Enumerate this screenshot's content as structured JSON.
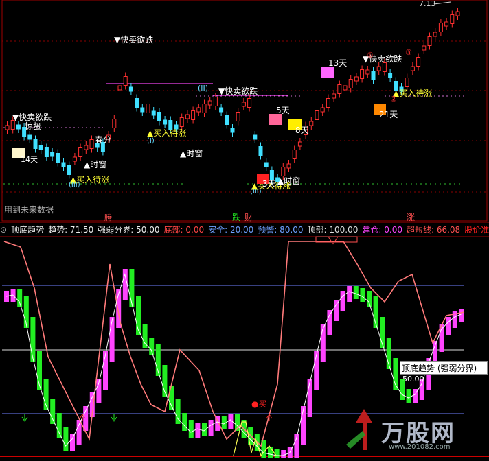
{
  "top_price": "7.13",
  "future_data_note": "用到未来数据",
  "signals": {
    "sell": "▼快卖欲跌",
    "buy": "▲买入待涨",
    "time_window": "▲时窗",
    "spring": "春分",
    "low_label": "惊蛰",
    "day13": "13天",
    "day5": "5天",
    "day8": "8天",
    "day21": "21天",
    "day3": "3天",
    "day14": "14天",
    "roman_I": "(I)",
    "roman_II": "(II)",
    "roman_III_a": "(III)",
    "roman_III_b": "(III)",
    "circle_2": "②",
    "circle_3": "③",
    "circle_1": "①"
  },
  "axis_markers": {
    "teng": "腾",
    "die": "跌",
    "cai": "财",
    "zhang": "涨"
  },
  "indicator": {
    "name": "顶底趋势",
    "trend": "趋势: 71.50",
    "strong_weak": "强弱分界: 50.00",
    "bottom": "底部: 0.00",
    "safe": "安全: 20.00",
    "warn": "预警: 80.00",
    "top": "顶部: 100.00",
    "build": "建仓: 0.00",
    "short": "超短线: 66.08",
    "stock_ready": "股价准备"
  },
  "tooltip": {
    "text": "顶底趋势 (强弱分界)",
    "value": "50.00"
  },
  "low_marker": "●买",
  "watermark": {
    "title": "万股网",
    "url": "www.201082.com"
  },
  "colors": {
    "up": "#ff3030",
    "down": "#40e0ff",
    "pink": "#ff44ff",
    "green": "#22ee22"
  }
}
